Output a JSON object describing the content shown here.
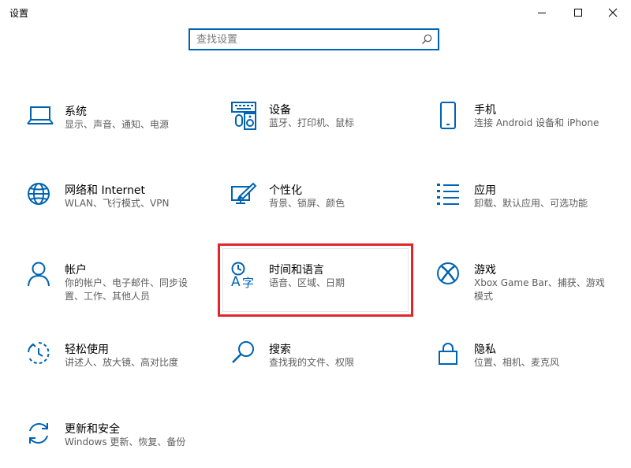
{
  "window": {
    "title": "设置"
  },
  "search": {
    "placeholder": "查找设置"
  },
  "items": [
    {
      "name": "系统",
      "desc": "显示、声音、通知、电源"
    },
    {
      "name": "设备",
      "desc": "蓝牙、打印机、鼠标"
    },
    {
      "name": "手机",
      "desc": "连接 Android 设备和 iPhone"
    },
    {
      "name": "网络和 Internet",
      "desc": "WLAN、飞行模式、VPN"
    },
    {
      "name": "个性化",
      "desc": "背景、锁屏、颜色"
    },
    {
      "name": "应用",
      "desc": "卸载、默认应用、可选功能"
    },
    {
      "name": "帐户",
      "desc": "你的帐户、电子邮件、同步设置、工作、其他人员"
    },
    {
      "name": "时间和语言",
      "desc": "语音、区域、日期"
    },
    {
      "name": "游戏",
      "desc": "Xbox Game Bar、捕获、游戏模式"
    },
    {
      "name": "轻松使用",
      "desc": "讲述人、放大镜、高对比度"
    },
    {
      "name": "搜索",
      "desc": "查找我的文件、权限"
    },
    {
      "name": "隐私",
      "desc": "位置、相机、麦克风"
    },
    {
      "name": "更新和安全",
      "desc": "Windows 更新、恢复、备份"
    }
  ],
  "colors": {
    "accent": "#0063b1",
    "highlight": "#e3242b"
  },
  "highlighted_item": "时间和语言"
}
